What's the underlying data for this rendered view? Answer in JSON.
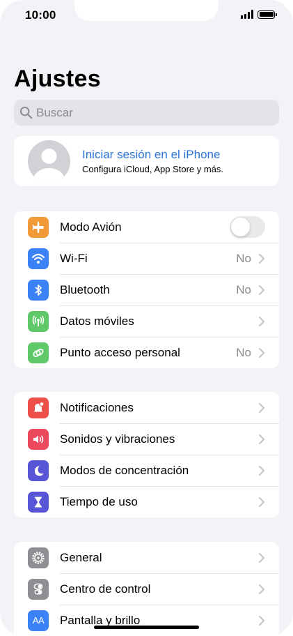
{
  "status_bar": {
    "time": "10:00"
  },
  "title": "Ajustes",
  "search": {
    "placeholder": "Buscar"
  },
  "account": {
    "signin_label": "Iniciar sesión en el iPhone",
    "subtitle": "Configura iCloud, App Store y más."
  },
  "connectivity": [
    {
      "label": "Modo Avión",
      "icon": "airplane-icon",
      "color": "#f29a38",
      "toggle": false
    },
    {
      "label": "Wi-Fi",
      "icon": "wifi-icon",
      "color": "#3b82f6",
      "value": "No"
    },
    {
      "label": "Bluetooth",
      "icon": "bluetooth-icon",
      "color": "#3b82f6",
      "value": "No"
    },
    {
      "label": "Datos móviles",
      "icon": "antenna-icon",
      "color": "#5fc96a"
    },
    {
      "label": "Punto acceso personal",
      "icon": "hotspot-icon",
      "color": "#5fc96a",
      "value": "No"
    }
  ],
  "notifications_group": [
    {
      "label": "Notificaciones",
      "icon": "bell-icon",
      "color": "#ee4f4a"
    },
    {
      "label": "Sonidos y vibraciones",
      "icon": "speaker-icon",
      "color": "#ec4a5c"
    },
    {
      "label": "Modos de concentración",
      "icon": "moon-icon",
      "color": "#5856d6"
    },
    {
      "label": "Tiempo de uso",
      "icon": "hourglass-icon",
      "color": "#5856d6"
    }
  ],
  "general_group": [
    {
      "label": "General",
      "icon": "gear-icon",
      "color": "#8e8e93"
    },
    {
      "label": "Centro de control",
      "icon": "switches-icon",
      "color": "#8e8e93"
    },
    {
      "label": "Pantalla y brillo",
      "icon": "text-size-icon",
      "color": "#3b82f6",
      "icon_text": "AA"
    }
  ]
}
